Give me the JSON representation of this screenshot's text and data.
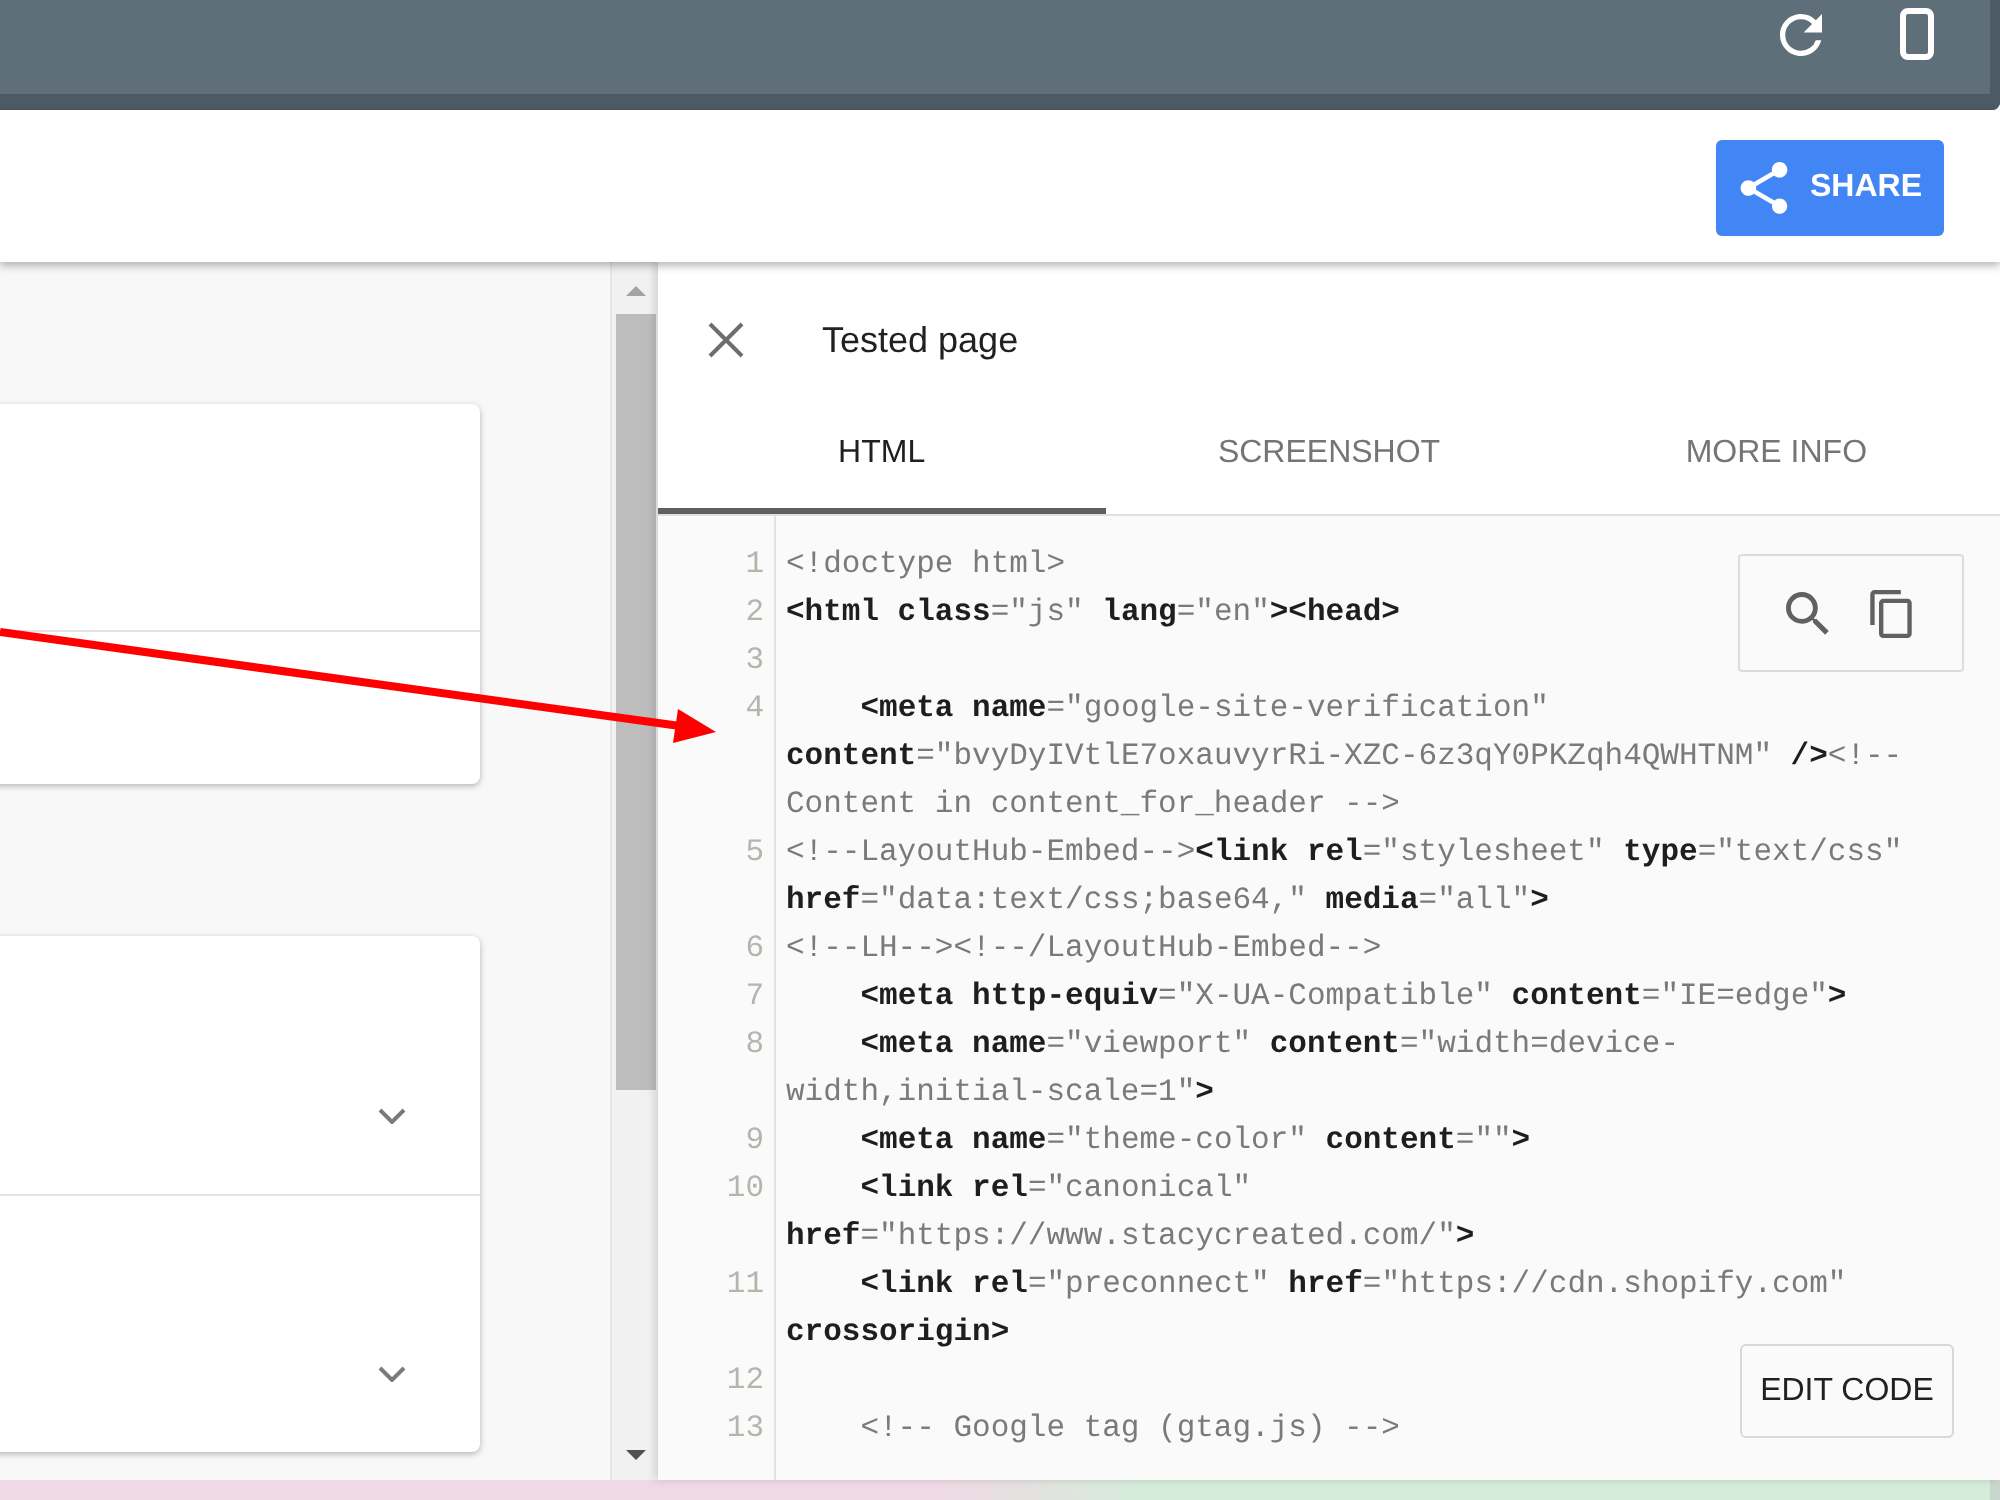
{
  "header": {
    "share_button": "SHARE"
  },
  "left_panel": {
    "accordion_rows": [
      {
        "expanded": false
      },
      {
        "expanded": false
      }
    ]
  },
  "panel": {
    "title": "Tested page",
    "tabs": [
      {
        "label": "HTML",
        "selected": true
      },
      {
        "label": "SCREENSHOT",
        "selected": false
      },
      {
        "label": "MORE INFO",
        "selected": false
      }
    ],
    "code_lines": [
      {
        "number": "1",
        "rows": [
          "<!doctype html>"
        ]
      },
      {
        "number": "2",
        "rows": [
          "**<html class**=\"js\" **lang**=\"en\"**><head>**"
        ]
      },
      {
        "number": "3"
      },
      {
        "number": "4",
        "rows": [
          "    **<meta name**=\"google-site-verification\"",
          "**content**=\"bvyDyIVtlE7oxauvyrRi-XZC-6z3qY0PKZqh4QWHTNM\" **/>**<!--",
          "Content in content_for_header -->"
        ]
      },
      {
        "number": "5",
        "rows": [
          "<!--LayoutHub-Embed-->**<link rel**=\"stylesheet\" **type**=\"text/css\"",
          "**href**=\"data:text/css;base64,\" **media**=\"all\"**>**"
        ]
      },
      {
        "number": "6",
        "rows": [
          "<!--LH--><!--/LayoutHub-Embed-->"
        ]
      },
      {
        "number": "7",
        "rows": [
          "    **<meta http-equiv**=\"X-UA-Compatible\" **content**=\"IE=edge\"**>**"
        ]
      },
      {
        "number": "8",
        "rows": [
          "    **<meta name**=\"viewport\" **content**=\"width=device-",
          "width,initial-scale=1\"**>**"
        ]
      },
      {
        "number": "9",
        "rows": [
          "    **<meta name**=\"theme-color\" **content**=\"\"**>**"
        ]
      },
      {
        "number": "10",
        "rows": [
          "    **<link rel**=\"canonical\"",
          "**href**=\"https://www.stacycreated.com/\"**>**"
        ]
      },
      {
        "number": "11",
        "rows": [
          "    **<link rel**=\"preconnect\" **href**=\"https://cdn.shopify.com\"",
          "**crossorigin>**"
        ]
      },
      {
        "number": "12"
      },
      {
        "number": "13",
        "rows": [
          "    <!-- Google tag (gtag.js) -->"
        ]
      }
    ],
    "edit_button": "EDIT CODE"
  }
}
